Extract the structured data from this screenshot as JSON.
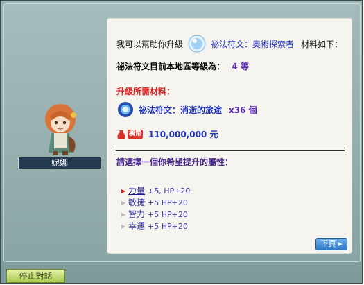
{
  "npc": {
    "name": "妮娜"
  },
  "dialog": {
    "line1_prefix": "我可以幫助你升級",
    "line1_item": "祕法符文：奧術探索者",
    "line1_suffix": "材料如下：",
    "line2_label": "祕法符文目前本地區等級為：",
    "line2_level": "4 等",
    "materials_heading": "升級所需材料：",
    "material_item": "祕法符文：消逝的旅途",
    "material_qty": "x36 個",
    "meso_tag": "楓幣",
    "meso_amount": "110,000,000 元",
    "choose_prompt": "請選擇一個你希望提升的屬性：",
    "options": [
      {
        "stat": "力量",
        "bonus": "+5, HP+20"
      },
      {
        "stat": "敏捷",
        "bonus": "+5 HP+20"
      },
      {
        "stat": "智力",
        "bonus": "+5 HP+20"
      },
      {
        "stat": "幸運",
        "bonus": "+5 HP+20"
      }
    ],
    "next_label": "下頁 ▸"
  },
  "footer": {
    "end_chat_label": "停止對話"
  },
  "colors": {
    "accent_blue": "#2233bb",
    "warning_red": "#e02020",
    "purple": "#5a2ab5"
  }
}
